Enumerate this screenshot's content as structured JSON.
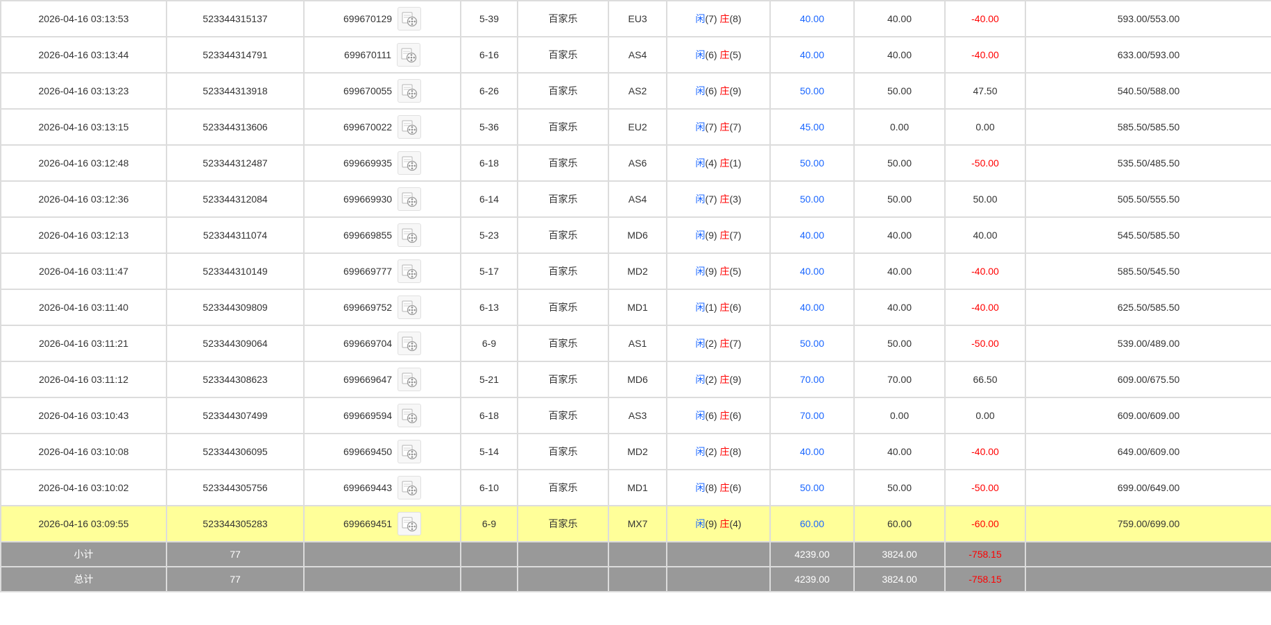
{
  "colors": {
    "player": "#1a66ff",
    "banker": "#ff0000",
    "highlight": "#ffff99",
    "summary_bg": "#999999"
  },
  "rows": [
    {
      "time": "2026-04-16 03:13:53",
      "order": "523344315137",
      "bet": "699670129",
      "round": "5-39",
      "game": "百家乐",
      "table": "EU3",
      "player_tag": "闲",
      "player_pts": "(7)",
      "banker_tag": "庄",
      "banker_pts": "(8)",
      "bet_amount": "40.00",
      "valid": "40.00",
      "result": "-40.00",
      "negative": true,
      "balance": "593.00/553.00"
    },
    {
      "time": "2026-04-16 03:13:44",
      "order": "523344314791",
      "bet": "699670111",
      "round": "6-16",
      "game": "百家乐",
      "table": "AS4",
      "player_tag": "闲",
      "player_pts": "(6)",
      "banker_tag": "庄",
      "banker_pts": "(5)",
      "bet_amount": "40.00",
      "valid": "40.00",
      "result": "-40.00",
      "negative": true,
      "balance": "633.00/593.00"
    },
    {
      "time": "2026-04-16 03:13:23",
      "order": "523344313918",
      "bet": "699670055",
      "round": "6-26",
      "game": "百家乐",
      "table": "AS2",
      "player_tag": "闲",
      "player_pts": "(6)",
      "banker_tag": "庄",
      "banker_pts": "(9)",
      "bet_amount": "50.00",
      "valid": "50.00",
      "result": "47.50",
      "negative": false,
      "balance": "540.50/588.00"
    },
    {
      "time": "2026-04-16 03:13:15",
      "order": "523344313606",
      "bet": "699670022",
      "round": "5-36",
      "game": "百家乐",
      "table": "EU2",
      "player_tag": "闲",
      "player_pts": "(7)",
      "banker_tag": "庄",
      "banker_pts": "(7)",
      "bet_amount": "45.00",
      "valid": "0.00",
      "result": "0.00",
      "negative": false,
      "balance": "585.50/585.50"
    },
    {
      "time": "2026-04-16 03:12:48",
      "order": "523344312487",
      "bet": "699669935",
      "round": "6-18",
      "game": "百家乐",
      "table": "AS6",
      "player_tag": "闲",
      "player_pts": "(4)",
      "banker_tag": "庄",
      "banker_pts": "(1)",
      "bet_amount": "50.00",
      "valid": "50.00",
      "result": "-50.00",
      "negative": true,
      "balance": "535.50/485.50"
    },
    {
      "time": "2026-04-16 03:12:36",
      "order": "523344312084",
      "bet": "699669930",
      "round": "6-14",
      "game": "百家乐",
      "table": "AS4",
      "player_tag": "闲",
      "player_pts": "(7)",
      "banker_tag": "庄",
      "banker_pts": "(3)",
      "bet_amount": "50.00",
      "valid": "50.00",
      "result": "50.00",
      "negative": false,
      "balance": "505.50/555.50"
    },
    {
      "time": "2026-04-16 03:12:13",
      "order": "523344311074",
      "bet": "699669855",
      "round": "5-23",
      "game": "百家乐",
      "table": "MD6",
      "player_tag": "闲",
      "player_pts": "(9)",
      "banker_tag": "庄",
      "banker_pts": "(7)",
      "bet_amount": "40.00",
      "valid": "40.00",
      "result": "40.00",
      "negative": false,
      "balance": "545.50/585.50"
    },
    {
      "time": "2026-04-16 03:11:47",
      "order": "523344310149",
      "bet": "699669777",
      "round": "5-17",
      "game": "百家乐",
      "table": "MD2",
      "player_tag": "闲",
      "player_pts": "(9)",
      "banker_tag": "庄",
      "banker_pts": "(5)",
      "bet_amount": "40.00",
      "valid": "40.00",
      "result": "-40.00",
      "negative": true,
      "balance": "585.50/545.50"
    },
    {
      "time": "2026-04-16 03:11:40",
      "order": "523344309809",
      "bet": "699669752",
      "round": "6-13",
      "game": "百家乐",
      "table": "MD1",
      "player_tag": "闲",
      "player_pts": "(1)",
      "banker_tag": "庄",
      "banker_pts": "(6)",
      "bet_amount": "40.00",
      "valid": "40.00",
      "result": "-40.00",
      "negative": true,
      "balance": "625.50/585.50"
    },
    {
      "time": "2026-04-16 03:11:21",
      "order": "523344309064",
      "bet": "699669704",
      "round": "6-9",
      "game": "百家乐",
      "table": "AS1",
      "player_tag": "闲",
      "player_pts": "(2)",
      "banker_tag": "庄",
      "banker_pts": "(7)",
      "bet_amount": "50.00",
      "valid": "50.00",
      "result": "-50.00",
      "negative": true,
      "balance": "539.00/489.00"
    },
    {
      "time": "2026-04-16 03:11:12",
      "order": "523344308623",
      "bet": "699669647",
      "round": "5-21",
      "game": "百家乐",
      "table": "MD6",
      "player_tag": "闲",
      "player_pts": "(2)",
      "banker_tag": "庄",
      "banker_pts": "(9)",
      "bet_amount": "70.00",
      "valid": "70.00",
      "result": "66.50",
      "negative": false,
      "balance": "609.00/675.50"
    },
    {
      "time": "2026-04-16 03:10:43",
      "order": "523344307499",
      "bet": "699669594",
      "round": "6-18",
      "game": "百家乐",
      "table": "AS3",
      "player_tag": "闲",
      "player_pts": "(6)",
      "banker_tag": "庄",
      "banker_pts": "(6)",
      "bet_amount": "70.00",
      "valid": "0.00",
      "result": "0.00",
      "negative": false,
      "balance": "609.00/609.00"
    },
    {
      "time": "2026-04-16 03:10:08",
      "order": "523344306095",
      "bet": "699669450",
      "round": "5-14",
      "game": "百家乐",
      "table": "MD2",
      "player_tag": "闲",
      "player_pts": "(2)",
      "banker_tag": "庄",
      "banker_pts": "(8)",
      "bet_amount": "40.00",
      "valid": "40.00",
      "result": "-40.00",
      "negative": true,
      "balance": "649.00/609.00"
    },
    {
      "time": "2026-04-16 03:10:02",
      "order": "523344305756",
      "bet": "699669443",
      "round": "6-10",
      "game": "百家乐",
      "table": "MD1",
      "player_tag": "闲",
      "player_pts": "(8)",
      "banker_tag": "庄",
      "banker_pts": "(6)",
      "bet_amount": "50.00",
      "valid": "50.00",
      "result": "-50.00",
      "negative": true,
      "balance": "699.00/649.00"
    },
    {
      "time": "2026-04-16 03:09:55",
      "order": "523344305283",
      "bet": "699669451",
      "round": "6-9",
      "game": "百家乐",
      "table": "MX7",
      "player_tag": "闲",
      "player_pts": "(9)",
      "banker_tag": "庄",
      "banker_pts": "(4)",
      "bet_amount": "60.00",
      "valid": "60.00",
      "result": "-60.00",
      "negative": true,
      "balance": "759.00/699.00",
      "highlight": true
    }
  ],
  "summary": [
    {
      "label": "小计",
      "count": "77",
      "bet_amount": "4239.00",
      "valid": "3824.00",
      "result": "-758.15"
    },
    {
      "label": "总计",
      "count": "77",
      "bet_amount": "4239.00",
      "valid": "3824.00",
      "result": "-758.15"
    }
  ],
  "icons": {
    "replay": "film-reel-icon"
  }
}
